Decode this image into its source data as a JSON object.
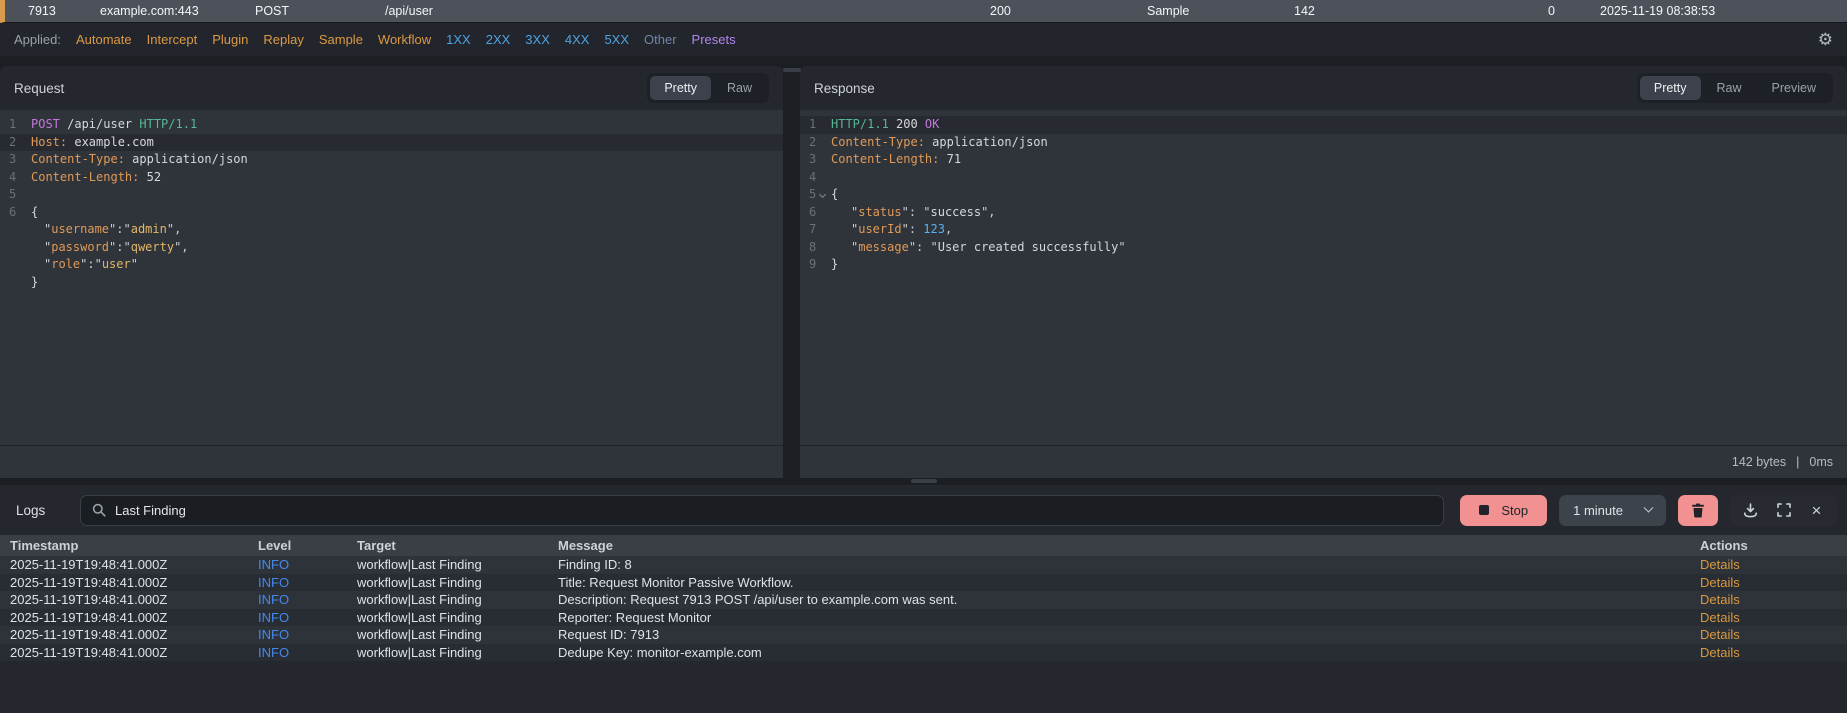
{
  "colors": {
    "accent_orange": "#d99a4e",
    "filter_orange": "#dc9a45",
    "filter_blue": "#4fa3e3",
    "presets_purple": "#b286ee",
    "info_blue": "#4488ec",
    "stop_pink": "#f29191",
    "details_orange": "#d9993f"
  },
  "request_row": {
    "id": "7913",
    "host": "example.com:443",
    "method": "POST",
    "path": "/api/user",
    "status": "200",
    "source": "Sample",
    "length": "142",
    "count": "0",
    "timestamp": "2025-11-19 08:38:53"
  },
  "filter_bar": {
    "label": "Applied:",
    "filters": [
      {
        "label": "Automate",
        "color": "orange"
      },
      {
        "label": "Intercept",
        "color": "orange"
      },
      {
        "label": "Plugin",
        "color": "orange"
      },
      {
        "label": "Replay",
        "color": "orange"
      },
      {
        "label": "Sample",
        "color": "orange"
      },
      {
        "label": "Workflow",
        "color": "orange"
      },
      {
        "label": "1XX",
        "color": "blue"
      },
      {
        "label": "2XX",
        "color": "blue"
      },
      {
        "label": "3XX",
        "color": "blue"
      },
      {
        "label": "4XX",
        "color": "blue"
      },
      {
        "label": "5XX",
        "color": "blue"
      },
      {
        "label": "Other",
        "color": "muted"
      },
      {
        "label": "Presets",
        "color": "purple"
      }
    ]
  },
  "request_panel": {
    "title": "Request",
    "tabs": [
      {
        "label": "Pretty",
        "selected": true
      },
      {
        "label": "Raw",
        "selected": false
      }
    ],
    "code": {
      "line1": {
        "num": "1",
        "method": "POST",
        "path": " /api/user",
        "protocol": " HTTP/1.1"
      },
      "line2": {
        "num": "2",
        "name": "Host:",
        "value": " example.com"
      },
      "line3": {
        "num": "3",
        "name": "Content-Type:",
        "value": " application/json"
      },
      "line4": {
        "num": "4",
        "name": "Content-Length:",
        "value": " 52"
      },
      "line5": {
        "num": "5"
      },
      "line6": {
        "num": "6",
        "text": "{"
      },
      "wrap1": {
        "qa": "\"",
        "key": "username",
        "qb": "\":\"",
        "value": "admin",
        "qc": "\","
      },
      "wrap2": {
        "qa": "\"",
        "key": "password",
        "qb": "\":\"",
        "value": "qwerty",
        "qc": "\","
      },
      "wrap3": {
        "qa": "\"",
        "key": "role",
        "qb": "\":\"",
        "value": "user",
        "qc": "\""
      },
      "wrap4": {
        "text": "}"
      }
    }
  },
  "response_panel": {
    "title": "Response",
    "tabs": [
      {
        "label": "Pretty",
        "selected": true
      },
      {
        "label": "Raw",
        "selected": false
      },
      {
        "label": "Preview",
        "selected": false
      }
    ],
    "code": {
      "line1": {
        "num": "1",
        "protocol": "HTTP/1.1",
        "status": " 200",
        "reason": " OK"
      },
      "line2": {
        "num": "2",
        "name": "Content-Type:",
        "value": " application/json"
      },
      "line3": {
        "num": "3",
        "name": "Content-Length:",
        "value": " 71"
      },
      "line4": {
        "num": "4"
      },
      "line5": {
        "num": "5",
        "text": "{"
      },
      "line6": {
        "qa": "\"",
        "num": "6",
        "key": "status",
        "qb": "\": \"",
        "value": "success",
        "qc": "\","
      },
      "line7": {
        "qa": "\"",
        "num": "7",
        "key": "userId",
        "qb": "\": ",
        "value": "123",
        "comma": ","
      },
      "line8": {
        "qa": "\"",
        "num": "8",
        "key": "message",
        "qb": "\": \"",
        "value": "User created successfully",
        "qc": "\""
      },
      "line9": {
        "num": "9",
        "text": "}"
      }
    },
    "footer": {
      "size": "142 bytes",
      "separator": "|",
      "time": "0ms"
    }
  },
  "logs": {
    "title": "Logs",
    "search": {
      "value": "Last Finding"
    },
    "stop_button": "Stop",
    "interval_select": "1 minute",
    "table": {
      "headers": {
        "timestamp": "Timestamp",
        "level": "Level",
        "target": "Target",
        "message": "Message",
        "actions": "Actions"
      },
      "rows": [
        {
          "timestamp": "2025-11-19T19:48:41.000Z",
          "level": "INFO",
          "target": "workflow|Last Finding",
          "message": "Finding ID: 8",
          "action": "Details"
        },
        {
          "timestamp": "2025-11-19T19:48:41.000Z",
          "level": "INFO",
          "target": "workflow|Last Finding",
          "message": "Title: Request Monitor Passive Workflow.",
          "action": "Details"
        },
        {
          "timestamp": "2025-11-19T19:48:41.000Z",
          "level": "INFO",
          "target": "workflow|Last Finding",
          "message": "Description: Request 7913 POST /api/user to example.com was sent.",
          "action": "Details"
        },
        {
          "timestamp": "2025-11-19T19:48:41.000Z",
          "level": "INFO",
          "target": "workflow|Last Finding",
          "message": "Reporter: Request Monitor",
          "action": "Details"
        },
        {
          "timestamp": "2025-11-19T19:48:41.000Z",
          "level": "INFO",
          "target": "workflow|Last Finding",
          "message": "Request ID: 7913",
          "action": "Details"
        },
        {
          "timestamp": "2025-11-19T19:48:41.000Z",
          "level": "INFO",
          "target": "workflow|Last Finding",
          "message": "Dedupe Key: monitor-example.com",
          "action": "Details"
        }
      ]
    }
  }
}
